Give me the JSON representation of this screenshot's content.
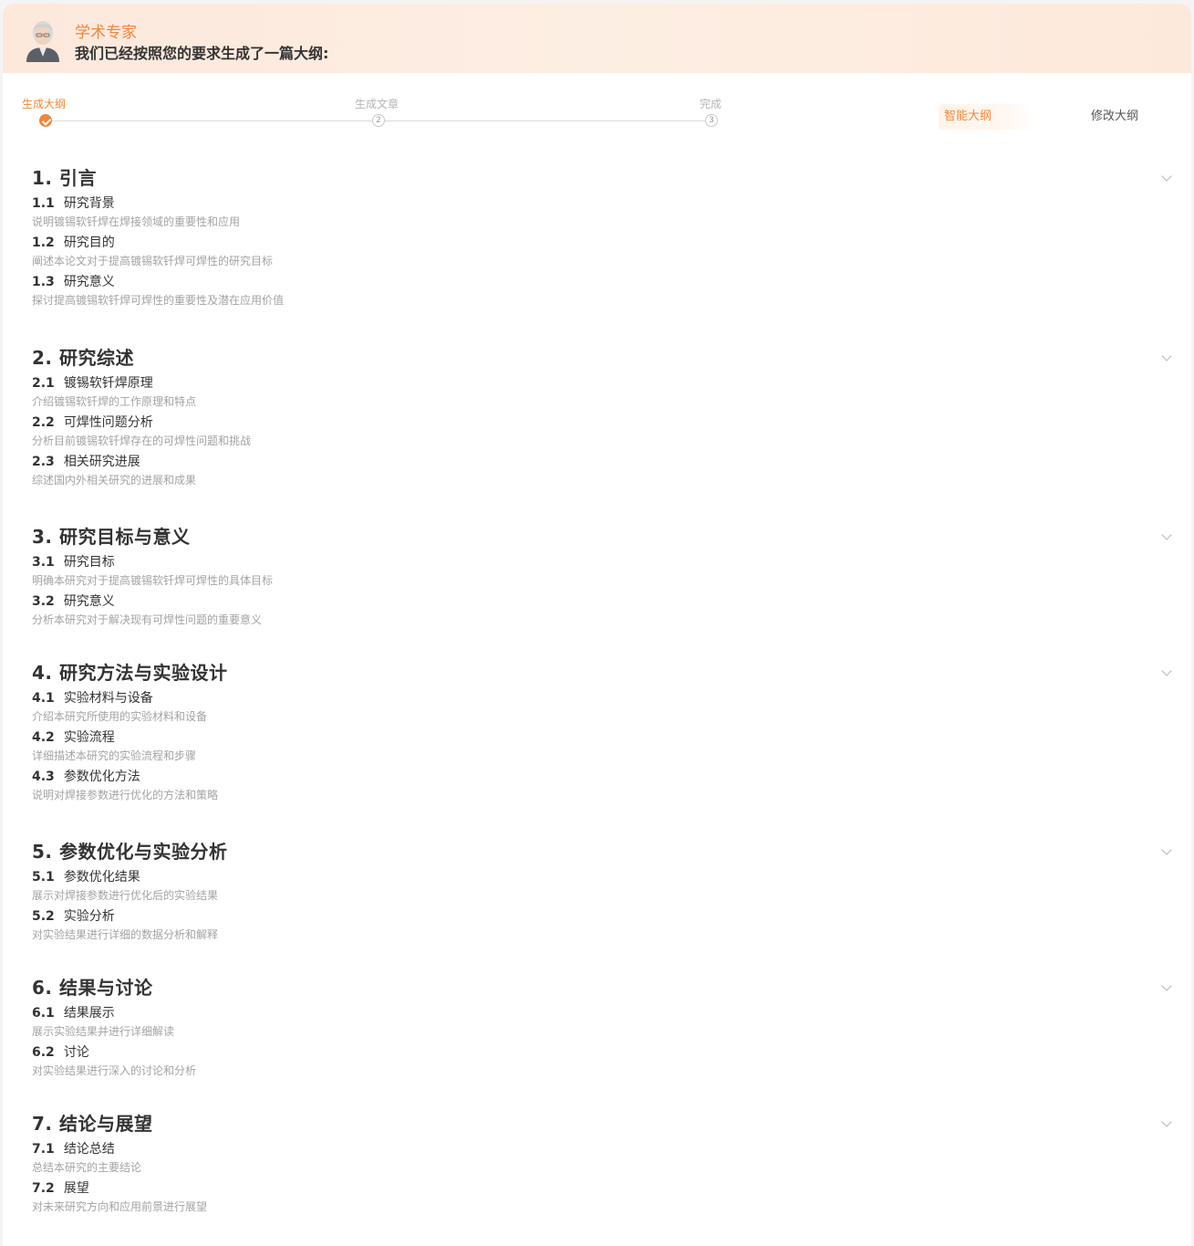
{
  "header": {
    "expert_name": "学术专家",
    "message": "我们已经按照您的要求生成了一篇大纲:"
  },
  "steps": [
    {
      "label": "生成大纲",
      "number": "1",
      "state": "done"
    },
    {
      "label": "生成文章",
      "number": "2",
      "state": "pending"
    },
    {
      "label": "完成",
      "number": "3",
      "state": "pending"
    }
  ],
  "mode_tabs": {
    "smart": "智能大纲",
    "edit": "修改大纲"
  },
  "colors": {
    "accent": "#f0873a",
    "muted": "#a3a3a3"
  },
  "outline": [
    {
      "title": "1.  引言",
      "items": [
        {
          "num": "1.1",
          "title": "研究背景",
          "desc": "说明镀锡软钎焊在焊接领域的重要性和应用"
        },
        {
          "num": "1.2",
          "title": "研究目的",
          "desc": "阐述本论文对于提高镀锡软钎焊可焊性的研究目标"
        },
        {
          "num": "1.3",
          "title": "研究意义",
          "desc": "探讨提高镀锡软钎焊可焊性的重要性及潜在应用价值"
        }
      ]
    },
    {
      "title": "2.  研究综述",
      "items": [
        {
          "num": "2.1",
          "title": "镀锡软钎焊原理",
          "desc": "介绍镀锡软钎焊的工作原理和特点"
        },
        {
          "num": "2.2",
          "title": "可焊性问题分析",
          "desc": "分析目前镀锡软钎焊存在的可焊性问题和挑战"
        },
        {
          "num": "2.3",
          "title": "相关研究进展",
          "desc": "综述国内外相关研究的进展和成果"
        }
      ]
    },
    {
      "title": "3.  研究目标与意义",
      "items": [
        {
          "num": "3.1",
          "title": "研究目标",
          "desc": "明确本研究对于提高镀锡软钎焊可焊性的具体目标"
        },
        {
          "num": "3.2",
          "title": "研究意义",
          "desc": "分析本研究对于解决现有可焊性问题的重要意义"
        }
      ]
    },
    {
      "title": "4.  研究方法与实验设计",
      "items": [
        {
          "num": "4.1",
          "title": "实验材料与设备",
          "desc": "介绍本研究所使用的实验材料和设备"
        },
        {
          "num": "4.2",
          "title": "实验流程",
          "desc": "详细描述本研究的实验流程和步骤"
        },
        {
          "num": "4.3",
          "title": "参数优化方法",
          "desc": "说明对焊接参数进行优化的方法和策略"
        }
      ]
    },
    {
      "title": "5.  参数优化与实验分析",
      "items": [
        {
          "num": "5.1",
          "title": "参数优化结果",
          "desc": "展示对焊接参数进行优化后的实验结果"
        },
        {
          "num": "5.2",
          "title": "实验分析",
          "desc": "对实验结果进行详细的数据分析和解释"
        }
      ]
    },
    {
      "title": "6.  结果与讨论",
      "items": [
        {
          "num": "6.1",
          "title": "结果展示",
          "desc": "展示实验结果并进行详细解读"
        },
        {
          "num": "6.2",
          "title": "讨论",
          "desc": "对实验结果进行深入的讨论和分析"
        }
      ]
    },
    {
      "title": "7.  结论与展望",
      "items": [
        {
          "num": "7.1",
          "title": "结论总结",
          "desc": "总结本研究的主要结论"
        },
        {
          "num": "7.2",
          "title": "展望",
          "desc": "对未来研究方向和应用前景进行展望"
        }
      ]
    }
  ]
}
